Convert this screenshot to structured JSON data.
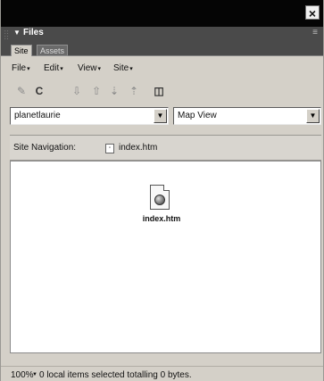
{
  "panel": {
    "title": "Files",
    "close_icon": "×",
    "options_icon": "≡"
  },
  "tabs": [
    {
      "label": "Site",
      "active": true
    },
    {
      "label": "Assets",
      "active": false
    }
  ],
  "menubar": {
    "items": [
      {
        "label": "File"
      },
      {
        "label": "Edit"
      },
      {
        "label": "View"
      },
      {
        "label": "Site"
      }
    ]
  },
  "toolbar": {
    "buttons": [
      {
        "icon": "connect-icon",
        "glyph": "✎"
      },
      {
        "icon": "refresh-icon",
        "glyph": "C"
      },
      {
        "icon": "get-file-icon",
        "glyph": "⇩"
      },
      {
        "icon": "put-file-icon",
        "glyph": "⇧"
      },
      {
        "icon": "check-out-icon",
        "glyph": "⇣"
      },
      {
        "icon": "check-in-icon",
        "glyph": "⇡"
      },
      {
        "icon": "expand-collapse-icon",
        "glyph": "◫"
      }
    ]
  },
  "site_select": {
    "value": "planetlaurie"
  },
  "view_select": {
    "value": "Map View"
  },
  "site_navigation": {
    "label": "Site Navigation:",
    "file": "index.htm"
  },
  "map": {
    "file_name": "index.htm"
  },
  "status": {
    "zoom": "100%",
    "message": "0 local items selected totalling 0 bytes."
  },
  "colors": {
    "titlebar": "#050505",
    "panel_bar": "#4a4a4a",
    "window_bg": "#d4d0c8"
  }
}
